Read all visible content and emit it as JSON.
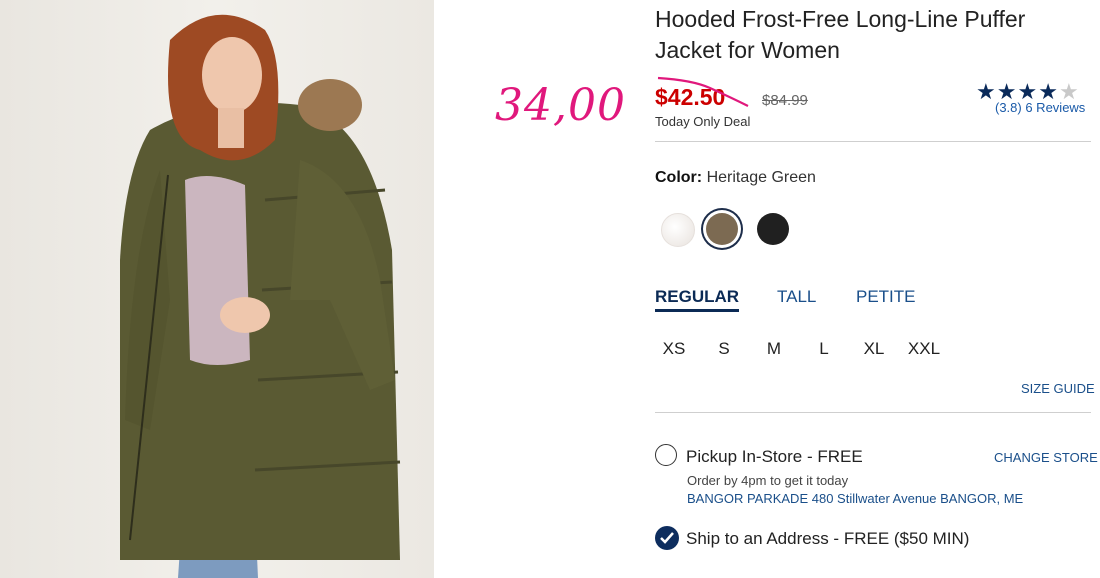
{
  "annotation": {
    "handwritten_price": "34,00"
  },
  "product": {
    "title": "Hooded Frost-Free Long-Line Puffer Jacket for Women",
    "sale_price": "$42.50",
    "original_price": "$84.99",
    "deal_label": "Today Only Deal",
    "rating": {
      "stars_filled": 4,
      "stars_total": 5,
      "text": "(3.8) 6 Reviews"
    }
  },
  "color": {
    "label": "Color:",
    "selected": "Heritage Green",
    "swatches": [
      "cream-swatch",
      "heritage-green-swatch",
      "black-swatch"
    ]
  },
  "fit_tabs": [
    {
      "label": "REGULAR",
      "active": true
    },
    {
      "label": "TALL",
      "active": false
    },
    {
      "label": "PETITE",
      "active": false
    }
  ],
  "sizes": [
    "XS",
    "S",
    "M",
    "L",
    "XL",
    "XXL"
  ],
  "size_guide": "SIZE GUIDE",
  "fulfillment": {
    "pickup": {
      "label": "Pickup In-Store - FREE",
      "change_store": "CHANGE STORE",
      "note": "Order by 4pm to get it today",
      "store": "BANGOR PARKADE 480 Stillwater Avenue  BANGOR, ME"
    },
    "ship": {
      "label": "Ship to an Address - FREE ($50 MIN)",
      "selected": true
    }
  },
  "colors": {
    "sale": "#cc0000",
    "annotation": "#e0187c",
    "link": "#1a4f8a",
    "navy": "#0b2a55"
  }
}
